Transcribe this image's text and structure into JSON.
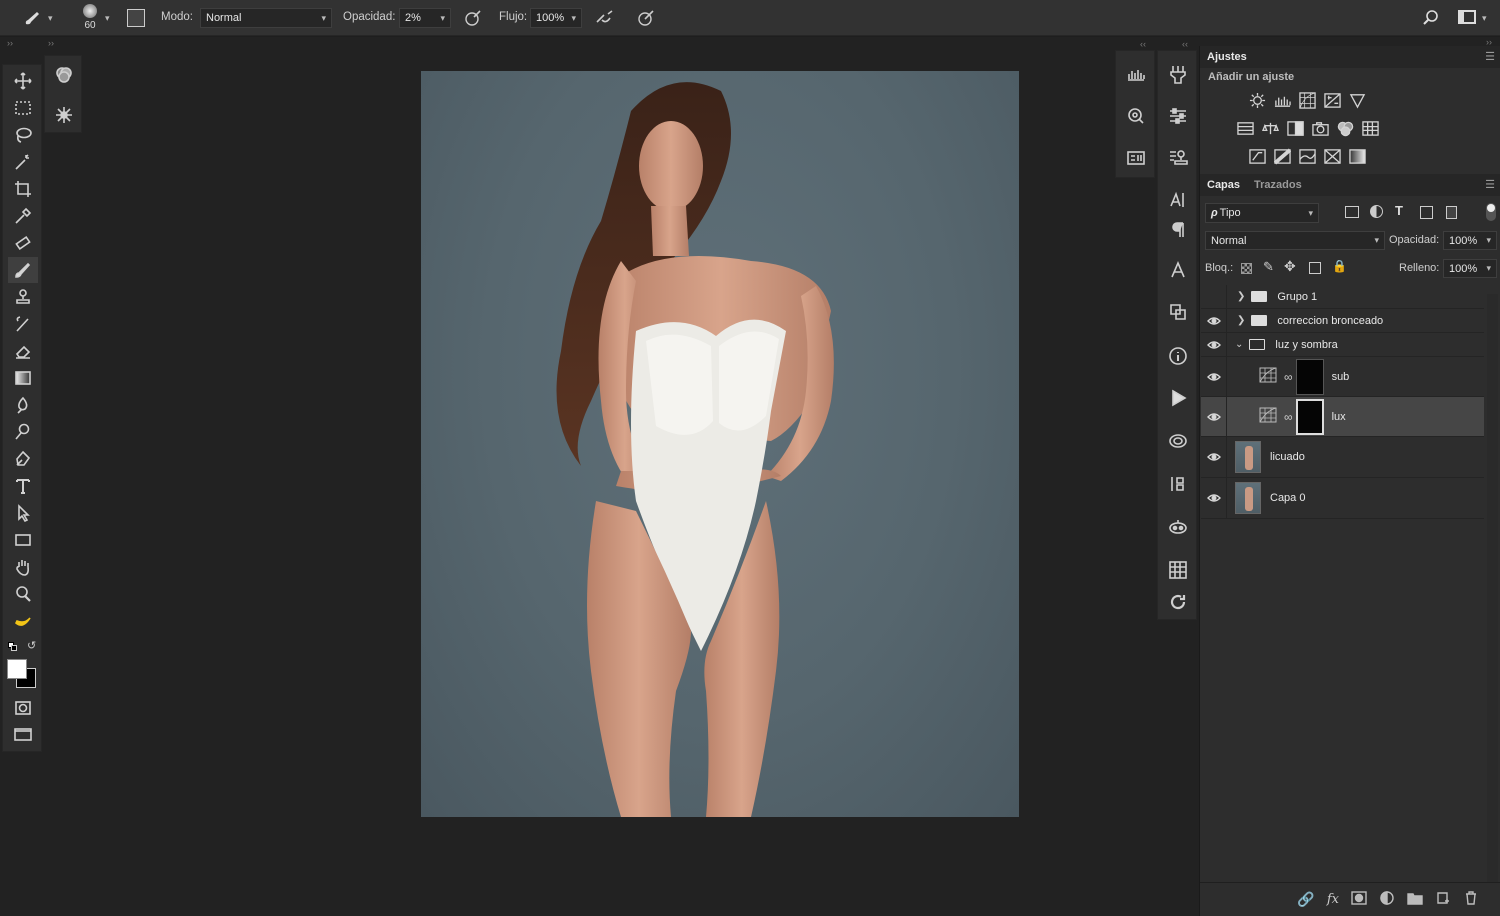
{
  "options_bar": {
    "brush_size": "60",
    "mode_label": "Modo:",
    "mode_value": "Normal",
    "opacity_label": "Opacidad:",
    "opacity_value": "2%",
    "flow_label": "Flujo:",
    "flow_value": "100%"
  },
  "adjustments_panel": {
    "title": "Ajustes",
    "subtitle": "Añadir un ajuste"
  },
  "layers_panel": {
    "tabs": [
      "Capas",
      "Trazados"
    ],
    "filter_kind": "Tipo",
    "blend_mode": "Normal",
    "opacity_label": "Opacidad:",
    "opacity_value": "100%",
    "lock_label": "Bloq.:",
    "fill_label": "Relleno:",
    "fill_value": "100%",
    "layers": [
      {
        "name": "Grupo 1",
        "type": "group",
        "visible": false,
        "expanded": false
      },
      {
        "name": "correccion bronceado",
        "type": "group",
        "visible": true,
        "expanded": false
      },
      {
        "name": "luz y sombra",
        "type": "group",
        "visible": true,
        "expanded": true
      },
      {
        "name": "sub",
        "type": "curves-with-mask",
        "visible": true,
        "selected": false
      },
      {
        "name": "lux",
        "type": "curves-with-mask",
        "visible": true,
        "selected": true
      },
      {
        "name": "licuado",
        "type": "pixel",
        "visible": true
      },
      {
        "name": "Capa 0",
        "type": "pixel",
        "visible": true
      }
    ]
  },
  "colors": {
    "foreground": "#ffffff",
    "background": "#000000",
    "canvas_backdrop": "#56666e"
  }
}
